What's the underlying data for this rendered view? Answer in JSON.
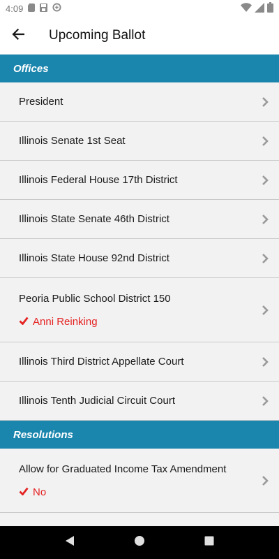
{
  "status_bar": {
    "time": "4:09"
  },
  "app_bar": {
    "title": "Upcoming Ballot"
  },
  "sections": [
    {
      "title": "Offices",
      "items": [
        {
          "label": "President"
        },
        {
          "label": "Illinois Senate 1st Seat"
        },
        {
          "label": "Illinois Federal House 17th District"
        },
        {
          "label": "Illinois State Senate 46th District"
        },
        {
          "label": "Illinois State House 92nd District"
        },
        {
          "label": "Peoria Public School District 150",
          "selection": "Anni Reinking"
        },
        {
          "label": "Illinois Third District Appellate Court"
        },
        {
          "label": "Illinois Tenth Judicial Circuit Court"
        }
      ]
    },
    {
      "title": "Resolutions",
      "items": [
        {
          "label": "Allow for Graduated Income Tax Amendment",
          "selection": "No"
        }
      ]
    }
  ],
  "colors": {
    "section_header": "#1a85ad",
    "selection": "#e52222",
    "row_background": "#f2f2f2"
  },
  "icons": {
    "back": "arrow-left-icon",
    "chevron": "chevron-right-icon",
    "check": "check-icon"
  }
}
